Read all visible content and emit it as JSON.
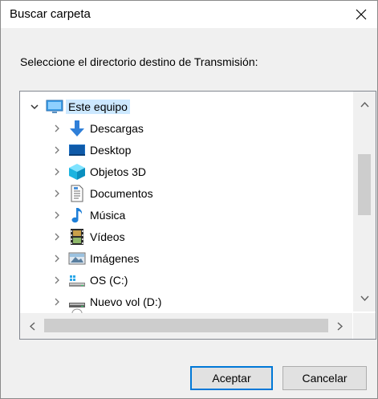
{
  "window": {
    "title": "Buscar carpeta"
  },
  "prompt": "Seleccione el directorio destino de Transmisión:",
  "tree": {
    "root": {
      "label": "Este equipo",
      "icon": "computer-icon",
      "selected": true
    },
    "items": [
      {
        "label": "Descargas",
        "icon": "download-arrow-icon"
      },
      {
        "label": "Desktop",
        "icon": "desktop-icon"
      },
      {
        "label": "Objetos 3D",
        "icon": "cube-3d-icon"
      },
      {
        "label": "Documentos",
        "icon": "document-icon"
      },
      {
        "label": "Música",
        "icon": "music-note-icon"
      },
      {
        "label": "Vídeos",
        "icon": "film-icon"
      },
      {
        "label": "Imágenes",
        "icon": "image-icon"
      },
      {
        "label": "OS (C:)",
        "icon": "system-drive-icon"
      },
      {
        "label": "Nuevo vol (D:)",
        "icon": "drive-icon"
      }
    ]
  },
  "buttons": {
    "ok": "Aceptar",
    "cancel": "Cancelar"
  },
  "colors": {
    "selection": "#cce8ff",
    "accent": "#0078d7",
    "button": "#e1e1e1"
  }
}
